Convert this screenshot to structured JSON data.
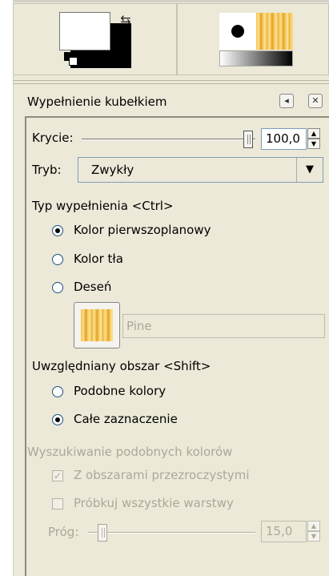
{
  "icons": {
    "swap": "swap-colors-icon",
    "reset": "default-colors-icon",
    "dock_menu": "dock-menu-icon",
    "dock_close": "close-icon"
  },
  "colors": {
    "foreground": "#ffffff",
    "background": "#000000"
  },
  "dock": {
    "title": "Wypełnienie kubełkiem",
    "menu_glyph": "◂",
    "close_glyph": "✕"
  },
  "opacity": {
    "label": "Krycie:",
    "value": "100,0",
    "fraction": 1.0
  },
  "mode": {
    "label": "Tryb:",
    "value": "Zwykły",
    "arrow": "▼"
  },
  "fill_type": {
    "heading": "Typ wypełnienia  <Ctrl>",
    "options": [
      {
        "label": "Kolor pierwszoplanowy",
        "selected": true
      },
      {
        "label": "Kolor tła",
        "selected": false
      },
      {
        "label": "Deseń",
        "selected": false
      }
    ],
    "pattern_name": "Pine"
  },
  "affected_area": {
    "heading": "Uwzględniany obszar  <Shift>",
    "options": [
      {
        "label": "Podobne kolory",
        "selected": false
      },
      {
        "label": "Całe zaznaczenie",
        "selected": true
      }
    ]
  },
  "similar_colors": {
    "heading": "Wyszukiwanie podobnych kolorów",
    "transparent": {
      "label": "Z obszarami przezroczystymi",
      "checked": true,
      "mark": "✓"
    },
    "sample_merged": {
      "label": "Próbkuj wszystkie warstwy",
      "checked": false
    },
    "threshold": {
      "label": "Próg:",
      "value": "15,0",
      "fraction": 0.059
    }
  },
  "spin": {
    "up": "▲",
    "down": "▼"
  }
}
